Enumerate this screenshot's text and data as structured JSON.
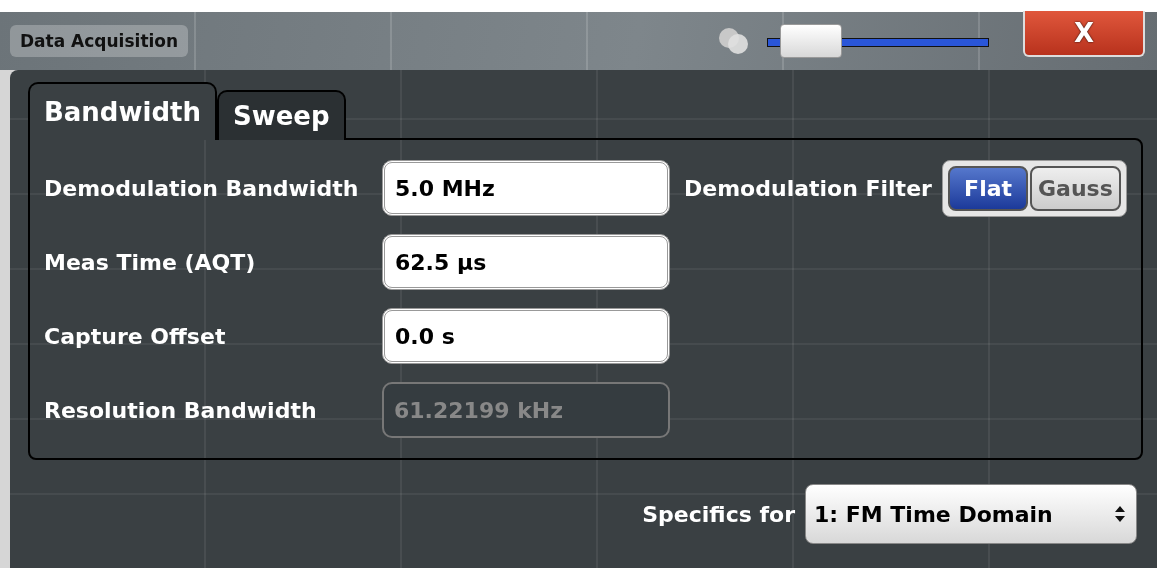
{
  "window": {
    "title": "Data Acquisition"
  },
  "transparency_slider": {
    "level": 0.2
  },
  "close_button": {
    "label": "X"
  },
  "tabs": [
    {
      "label": "Bandwidth",
      "selected": true
    },
    {
      "label": "Sweep",
      "selected": false
    }
  ],
  "fields": [
    {
      "label": "Demodulation Bandwidth",
      "value": "5.0 MHz",
      "disabled": false
    },
    {
      "label": "Meas Time (AQT)",
      "value": "62.5 µs",
      "disabled": false
    },
    {
      "label": "Capture Offset",
      "value": "0.0 s",
      "disabled": false
    },
    {
      "label": "Resolution Bandwidth",
      "value": "61.22199 kHz",
      "disabled": true
    }
  ],
  "demodulation_filter": {
    "label": "Demodulation Filter",
    "options": [
      {
        "label": "Flat",
        "selected": true
      },
      {
        "label": "Gauss",
        "selected": false
      }
    ]
  },
  "specifics": {
    "label": "Specifics for",
    "value": "1: FM Time Domain"
  }
}
